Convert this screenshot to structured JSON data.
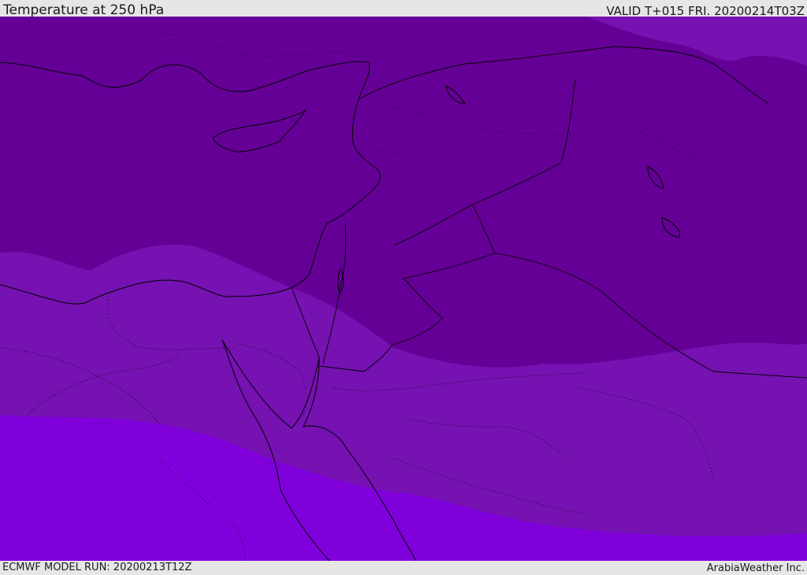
{
  "header": {
    "title": "Temperature at 250 hPa",
    "valid": "VALID T+015 FRI. 20200214T03Z"
  },
  "footer": {
    "model_run": "ECMWF MODEL RUN: 20200213T12Z",
    "brand": "ArabiaWeather Inc."
  },
  "map": {
    "colors": {
      "coldest_band": "#650097",
      "middle_band": "#7512b1",
      "warmest_band": "#8000dc",
      "top_right_band": "#7512b1",
      "coastline": "#000000",
      "borders": "#000000"
    }
  }
}
